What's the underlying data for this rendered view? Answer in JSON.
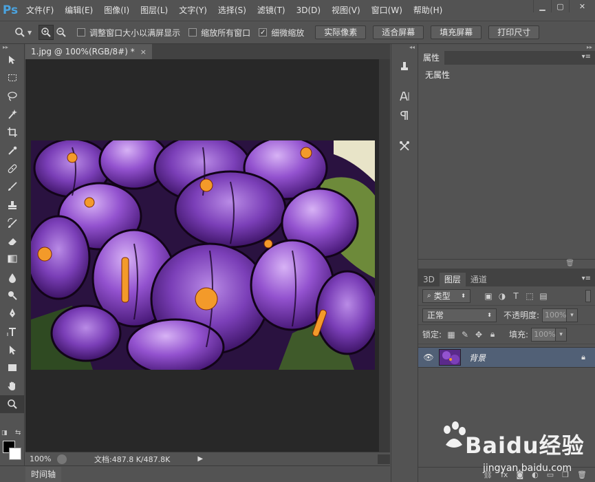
{
  "app": {
    "logo": "Ps"
  },
  "menu": [
    "文件(F)",
    "编辑(E)",
    "图像(I)",
    "图层(L)",
    "文字(Y)",
    "选择(S)",
    "滤镜(T)",
    "3D(D)",
    "视图(V)",
    "窗口(W)",
    "帮助(H)"
  ],
  "window_controls": {
    "minimize": "▁",
    "maximize": "▢",
    "close": "✕"
  },
  "options": {
    "resize_windows": {
      "label": "调整窗口大小以满屏显示",
      "checked": false
    },
    "zoom_all": {
      "label": "缩放所有窗口",
      "checked": false
    },
    "scrubby": {
      "label": "细微缩放",
      "checked": true
    },
    "btn_actual": "实际像素",
    "btn_fit": "适合屏幕",
    "btn_fill": "填充屏幕",
    "btn_print": "打印尺寸"
  },
  "document": {
    "tab_title": "1.jpg @ 100%(RGB/8#) *",
    "tab_close": "×"
  },
  "status": {
    "zoom": "100%",
    "doc_info": "文档:487.8 K/487.8K",
    "arrow": "▶"
  },
  "timeline": {
    "label": "时间轴"
  },
  "properties": {
    "tab": "属性",
    "empty": "无属性"
  },
  "layers": {
    "tabs": [
      "3D",
      "图层",
      "通道"
    ],
    "filter_label": "类型",
    "blend_mode": "正常",
    "opacity_label": "不透明度:",
    "opacity_value": "100%",
    "lock_label": "锁定:",
    "fill_label": "填充:",
    "fill_value": "100%",
    "items": [
      {
        "name": "背景",
        "locked": true
      }
    ]
  },
  "watermark": {
    "text": "Baidu经验",
    "url": "jingyan.baidu.com"
  },
  "colors": {
    "accent": "#4aa3df",
    "layer_selected": "#516076",
    "canvas_bg": "#282828",
    "panel_bg": "#535353"
  }
}
